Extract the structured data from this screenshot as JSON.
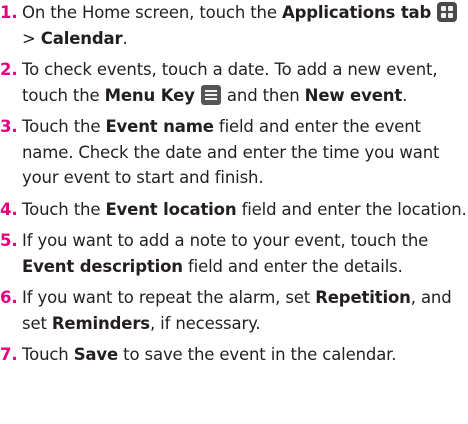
{
  "steps": [
    {
      "number": "1.",
      "parts": [
        {
          "t": "On the Home screen, touch the "
        },
        {
          "b": "Applications tab"
        },
        {
          "t": " "
        },
        {
          "icon": "apps-grid-icon"
        },
        {
          "t": " > "
        },
        {
          "b": "Calendar"
        },
        {
          "t": "."
        }
      ]
    },
    {
      "number": "2.",
      "parts": [
        {
          "t": "To check events, touch a date. To add a new event, touch the "
        },
        {
          "b": "Menu Key"
        },
        {
          "t": " "
        },
        {
          "icon": "menu-key-icon"
        },
        {
          "t": " and then "
        },
        {
          "b": "New event"
        },
        {
          "t": "."
        }
      ]
    },
    {
      "number": "3.",
      "parts": [
        {
          "t": "Touch the "
        },
        {
          "b": "Event name"
        },
        {
          "t": " field and enter the event name. Check the date and enter the time you want your event to start and finish."
        }
      ]
    },
    {
      "number": "4.",
      "parts": [
        {
          "t": "Touch the "
        },
        {
          "b": "Event location"
        },
        {
          "t": " field and enter the location."
        }
      ]
    },
    {
      "number": "5.",
      "parts": [
        {
          "t": "If you want to add a note to your event, touch the "
        },
        {
          "b": "Event description"
        },
        {
          "t": " field and enter the details."
        }
      ]
    },
    {
      "number": "6.",
      "parts": [
        {
          "t": "If you want to repeat the alarm, set "
        },
        {
          "b": "Repetition"
        },
        {
          "t": ", and set "
        },
        {
          "b": "Reminders"
        },
        {
          "t": ", if necessary."
        }
      ]
    },
    {
      "number": "7.",
      "parts": [
        {
          "t": "Touch "
        },
        {
          "b": "Save"
        },
        {
          "t": " to save the event in the calendar."
        }
      ]
    }
  ],
  "colors": {
    "step_number": "#e4007f",
    "text": "#231f20"
  }
}
